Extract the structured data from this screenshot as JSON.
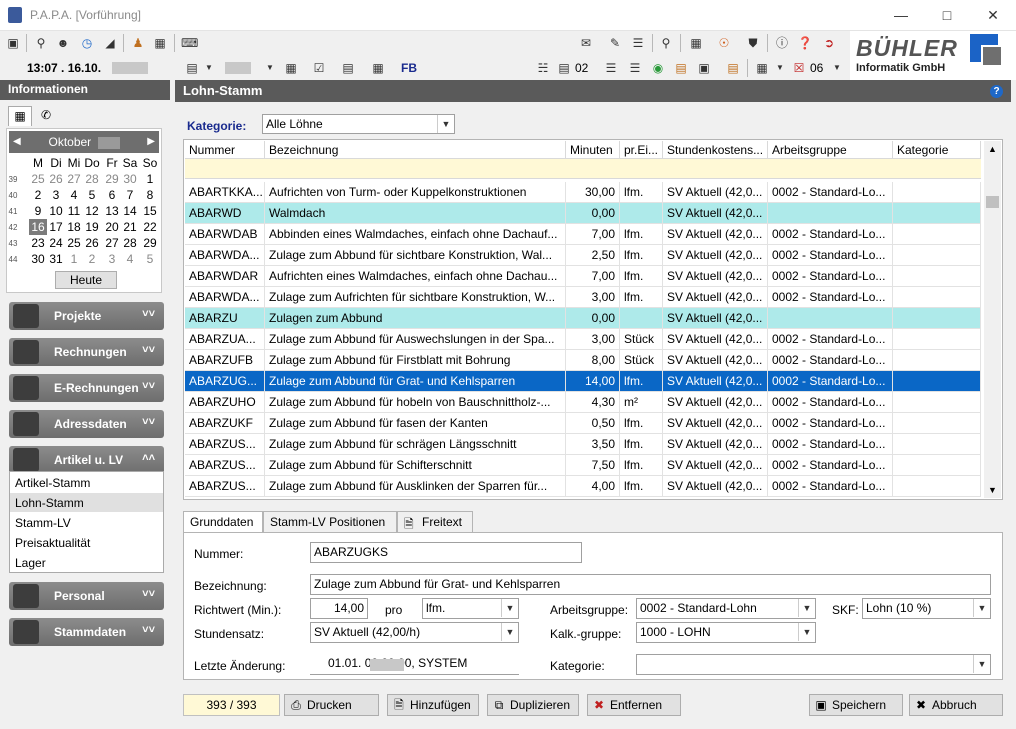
{
  "window": {
    "title": "P.A.P.A. [Vorführung]"
  },
  "toolbar": {
    "time_date": "13:07 . 16.10.",
    "fb_label": "FB",
    "count_02": "02",
    "count_06": "06"
  },
  "logo": {
    "line1": "BÜHLER",
    "line2": "Informatik GmbH"
  },
  "sidebar": {
    "title": "Informationen",
    "calendar": {
      "month": "Oktober",
      "weekdays": [
        "M",
        "Di",
        "Mi",
        "Do",
        "Fr",
        "Sa",
        "So"
      ],
      "weeks": [
        {
          "wk": "39",
          "days": [
            "25",
            "26",
            "27",
            "28",
            "29",
            "30",
            "1"
          ]
        },
        {
          "wk": "40",
          "days": [
            "2",
            "3",
            "4",
            "5",
            "6",
            "7",
            "8"
          ]
        },
        {
          "wk": "41",
          "days": [
            "9",
            "10",
            "11",
            "12",
            "13",
            "14",
            "15"
          ]
        },
        {
          "wk": "42",
          "days": [
            "16",
            "17",
            "18",
            "19",
            "20",
            "21",
            "22"
          ]
        },
        {
          "wk": "43",
          "days": [
            "23",
            "24",
            "25",
            "26",
            "27",
            "28",
            "29"
          ]
        },
        {
          "wk": "44",
          "days": [
            "30",
            "31",
            "1",
            "2",
            "3",
            "4",
            "5"
          ]
        }
      ],
      "today_label": "Heute"
    },
    "nav": [
      "Projekte",
      "Rechnungen",
      "E-Rechnungen",
      "Adressdaten",
      "Artikel u. LV",
      "Personal",
      "Stammdaten"
    ],
    "submenu": [
      "Artikel-Stamm",
      "Lohn-Stamm",
      "Stamm-LV",
      "Preisaktualität",
      "Lager"
    ]
  },
  "main": {
    "title": "Lohn-Stamm",
    "kategorie_label": "Kategorie:",
    "kategorie_value": "Alle Löhne",
    "columns": [
      "Nummer",
      "Bezeichnung",
      "Minuten",
      "pr.Ei...",
      "Stundenkostens...",
      "Arbeitsgruppe",
      "Kategorie"
    ],
    "rows": [
      {
        "nr": "ABARTKKA...",
        "bez": "Aufrichten von Turm- oder Kuppelkonstruktionen",
        "min": "30,00",
        "ein": "lfm.",
        "sk": "SV Aktuell (42,0...",
        "ag": "0002 - Standard-Lo...",
        "kat": "",
        "type": ""
      },
      {
        "nr": "ABARWD",
        "bez": "Walmdach",
        "min": "0,00",
        "ein": "",
        "sk": "SV Aktuell (42,0...",
        "ag": "",
        "kat": "",
        "type": "group"
      },
      {
        "nr": "ABARWDAB",
        "bez": "Abbinden eines Walmdaches, einfach ohne Dachauf...",
        "min": "7,00",
        "ein": "lfm.",
        "sk": "SV Aktuell (42,0...",
        "ag": "0002 - Standard-Lo...",
        "kat": "",
        "type": ""
      },
      {
        "nr": "ABARWDA...",
        "bez": "Zulage zum Abbund für sichtbare Konstruktion, Wal...",
        "min": "2,50",
        "ein": "lfm.",
        "sk": "SV Aktuell (42,0...",
        "ag": "0002 - Standard-Lo...",
        "kat": "",
        "type": ""
      },
      {
        "nr": "ABARWDAR",
        "bez": "Aufrichten eines Walmdaches, einfach ohne Dachau...",
        "min": "7,00",
        "ein": "lfm.",
        "sk": "SV Aktuell (42,0...",
        "ag": "0002 - Standard-Lo...",
        "kat": "",
        "type": ""
      },
      {
        "nr": "ABARWDA...",
        "bez": "Zulage zum Aufrichten für sichtbare Konstruktion, W...",
        "min": "3,00",
        "ein": "lfm.",
        "sk": "SV Aktuell (42,0...",
        "ag": "0002 - Standard-Lo...",
        "kat": "",
        "type": ""
      },
      {
        "nr": "ABARZU",
        "bez": "Zulagen zum Abbund",
        "min": "0,00",
        "ein": "",
        "sk": "SV Aktuell (42,0...",
        "ag": "",
        "kat": "",
        "type": "group"
      },
      {
        "nr": "ABARZUA...",
        "bez": "Zulage zum Abbund für Auswechslungen in der Spa...",
        "min": "3,00",
        "ein": "Stück",
        "sk": "SV Aktuell (42,0...",
        "ag": "0002 - Standard-Lo...",
        "kat": "",
        "type": ""
      },
      {
        "nr": "ABARZUFB",
        "bez": "Zulage zum Abbund für Firstblatt mit Bohrung",
        "min": "8,00",
        "ein": "Stück",
        "sk": "SV Aktuell (42,0...",
        "ag": "0002 - Standard-Lo...",
        "kat": "",
        "type": ""
      },
      {
        "nr": "ABARZUG...",
        "bez": "Zulage zum Abbund für Grat- und Kehlsparren",
        "min": "14,00",
        "ein": "lfm.",
        "sk": "SV Aktuell (42,0...",
        "ag": "0002 - Standard-Lo...",
        "kat": "",
        "type": "sel"
      },
      {
        "nr": "ABARZUHO",
        "bez": "Zulage zum Abbund für hobeln von Bauschnittholz-...",
        "min": "4,30",
        "ein": "m²",
        "sk": "SV Aktuell (42,0...",
        "ag": "0002 - Standard-Lo...",
        "kat": "",
        "type": ""
      },
      {
        "nr": "ABARZUKF",
        "bez": "Zulage zum Abbund für fasen der Kanten",
        "min": "0,50",
        "ein": "lfm.",
        "sk": "SV Aktuell (42,0...",
        "ag": "0002 - Standard-Lo...",
        "kat": "",
        "type": ""
      },
      {
        "nr": "ABARZUS...",
        "bez": "Zulage zum Abbund für schrägen Längsschnitt",
        "min": "3,50",
        "ein": "lfm.",
        "sk": "SV Aktuell (42,0...",
        "ag": "0002 - Standard-Lo...",
        "kat": "",
        "type": ""
      },
      {
        "nr": "ABARZUS...",
        "bez": "Zulage zum Abbund für Schifterschnitt",
        "min": "7,50",
        "ein": "lfm.",
        "sk": "SV Aktuell (42,0...",
        "ag": "0002 - Standard-Lo...",
        "kat": "",
        "type": ""
      },
      {
        "nr": "ABARZUS...",
        "bez": "Zulage zum Abbund für Ausklinken der Sparren für...",
        "min": "4,00",
        "ein": "lfm.",
        "sk": "SV Aktuell (42,0...",
        "ag": "0002 - Standard-Lo...",
        "kat": "",
        "type": ""
      }
    ],
    "tabs": [
      "Grunddaten",
      "Stamm-LV Positionen",
      "Freitext"
    ],
    "detail": {
      "nummer_label": "Nummer:",
      "nummer": "ABARZUGKS",
      "bez_label": "Bezeichnung:",
      "bez": "Zulage zum Abbund für Grat- und Kehlsparren",
      "richtwert_label": "Richtwert (Min.):",
      "richtwert": "14,00",
      "pro_label": "pro",
      "einheit": "lfm.",
      "arbeitsgruppe_label": "Arbeitsgruppe:",
      "arbeitsgruppe": "0002 - Standard-Lohn",
      "skf_label": "SKF:",
      "skf": "Lohn (10 %)",
      "stundensatz_label": "Stundensatz:",
      "stundensatz": "SV Aktuell (42,00/h)",
      "kalk_label": "Kalk.-gruppe:",
      "kalk": "1000 - LOHN",
      "letzte_label": "Letzte Änderung:",
      "letzte": "01.01.        00:00:00, SYSTEM",
      "kategorie_label": "Kategorie:",
      "kategorie": ""
    },
    "footer": {
      "counter": "393 / 393",
      "drucken": "Drucken",
      "hinzufuegen": "Hinzufügen",
      "duplizieren": "Duplizieren",
      "entfernen": "Entfernen",
      "speichern": "Speichern",
      "abbruch": "Abbruch"
    }
  }
}
